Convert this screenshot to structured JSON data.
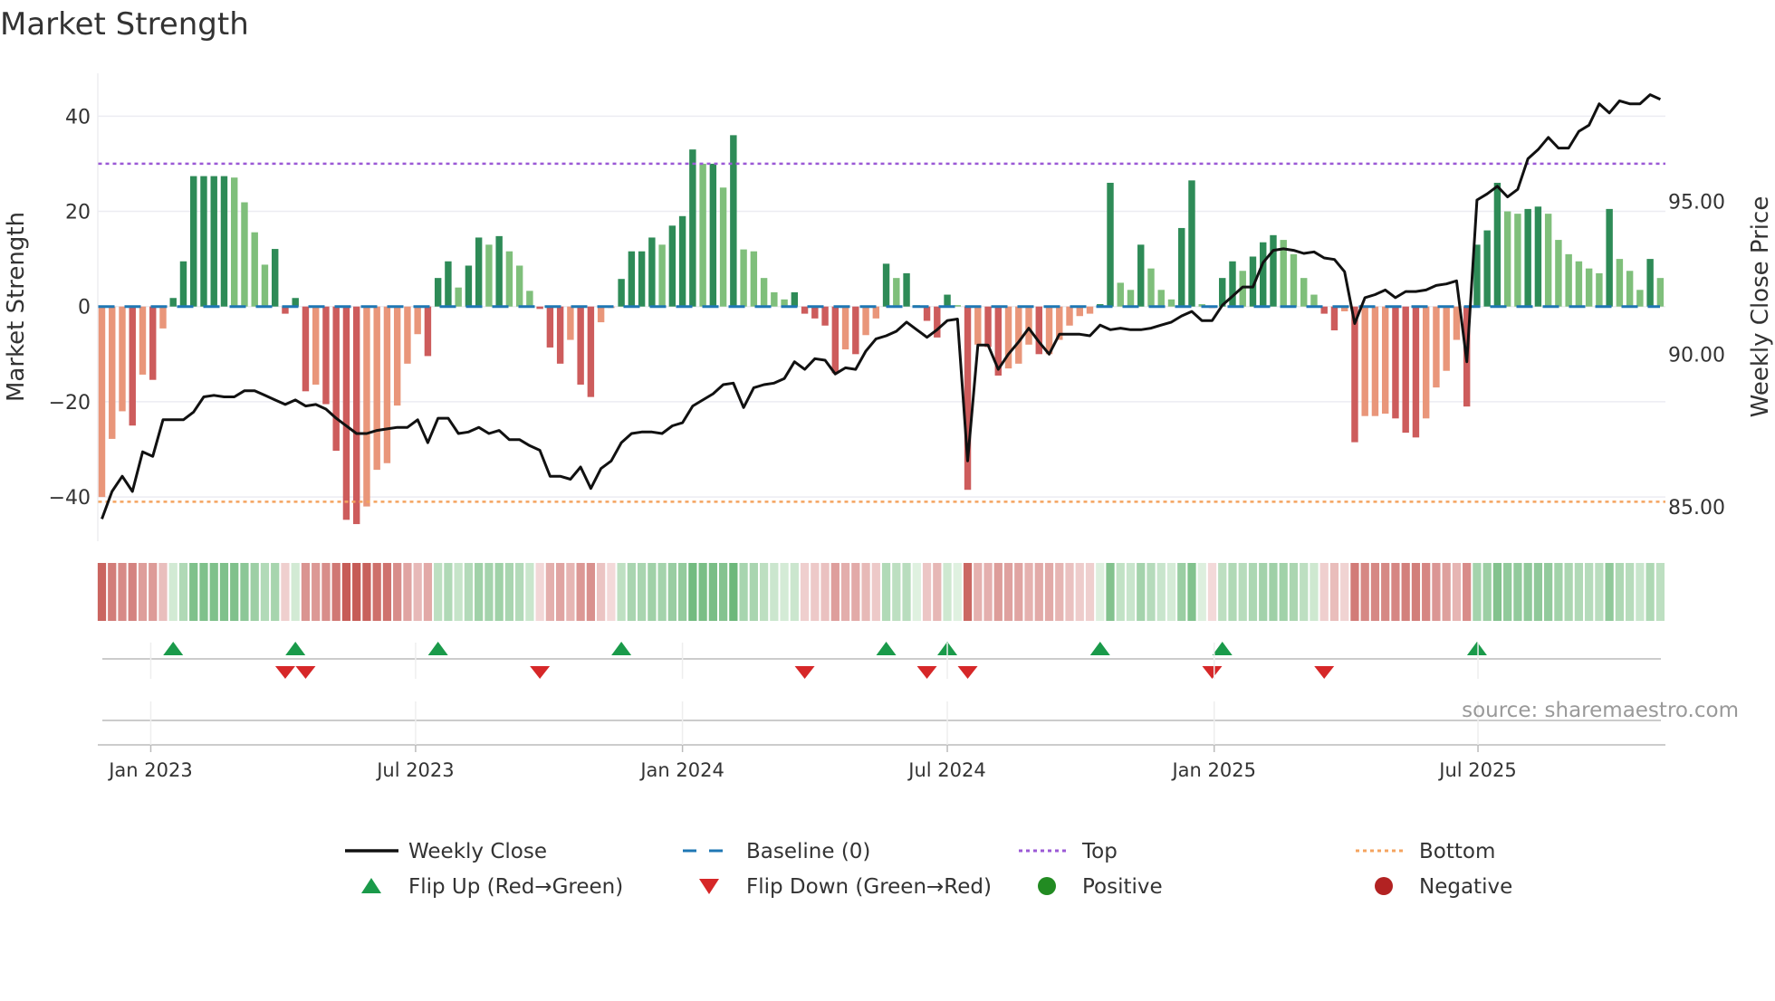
{
  "chart_data": {
    "type": "bar",
    "title": "Market Strength",
    "ylabel": "Market Strength",
    "y2label": "Weekly Close Price",
    "ylim": [
      -49.3,
      49
    ],
    "y2lim": [
      83.87,
      99.2
    ],
    "yticks": [
      40,
      20,
      0,
      -20,
      -40
    ],
    "ytick_labels": [
      "40",
      "20",
      "0",
      "−20",
      "−40"
    ],
    "y2ticks": [
      95,
      90,
      85
    ],
    "y2tick_labels": [
      "95.00",
      "90.00",
      "85.00"
    ],
    "x_unit": "week index",
    "xlim": [
      -0.4,
      153.5
    ],
    "xticks": [
      {
        "week": 4.8,
        "label": "Jan 2023"
      },
      {
        "week": 30.8,
        "label": "Jul 2023"
      },
      {
        "week": 57.0,
        "label": "Jan 2024"
      },
      {
        "week": 83.0,
        "label": "Jul 2024"
      },
      {
        "week": 109.2,
        "label": "Jan 2025"
      },
      {
        "week": 135.1,
        "label": "Jul 2025"
      }
    ],
    "top_level": 30,
    "bottom_level": -41,
    "baseline": 0,
    "strength": [
      -40,
      -27.8,
      -22,
      -25,
      -14.3,
      -15.4,
      -4.6,
      1.8,
      9.5,
      27.4,
      27.4,
      27.4,
      27.4,
      27.1,
      21.9,
      15.6,
      8.8,
      12.1,
      -1.5,
      1.8,
      -17.8,
      -16.4,
      -20.5,
      -30.3,
      -44.8,
      -45.7,
      -42,
      -34.3,
      -32.9,
      -20.8,
      -12,
      -5.8,
      -10.4,
      6,
      9.5,
      4,
      8.6,
      14.5,
      13,
      14.8,
      11.6,
      8.6,
      3.3,
      -0.5,
      -8.6,
      -12,
      -7,
      -16.4,
      -19,
      -3.3,
      -0.3,
      5.8,
      11.6,
      11.6,
      14.5,
      13,
      17,
      19,
      33,
      30,
      30,
      25,
      36,
      12,
      11.6,
      6,
      3,
      1.5,
      3,
      -1.5,
      -2.5,
      -4,
      -14,
      -9,
      -10,
      -6,
      -2.5,
      9,
      6,
      7,
      0.3,
      -3,
      -6.5,
      2.5,
      0.3,
      -38.5,
      -8,
      -8.5,
      -14.5,
      -13,
      -12,
      -8,
      -10,
      -10,
      -7,
      -4,
      -2,
      -1.5,
      0.5,
      26,
      5,
      3.5,
      13,
      8,
      3.5,
      1.5,
      16.5,
      26.5,
      0.5,
      -0.3,
      6,
      9.5,
      7.5,
      10.5,
      13.5,
      15,
      14,
      11,
      6,
      2.5,
      -1.5,
      -5,
      -1,
      -28.5,
      -23,
      -23,
      -22.5,
      -23.5,
      -26.5,
      -27.5,
      -23.5,
      -17,
      -13.5,
      -7,
      -21,
      13,
      16,
      26,
      20,
      19.5,
      20.5,
      21,
      19.5,
      14,
      11,
      9.5,
      8,
      7,
      20.5,
      10,
      7.5,
      3.5,
      10,
      6
    ],
    "weekly_close": [
      84.6,
      85.5,
      86.0,
      85.5,
      86.8,
      86.65,
      87.85,
      87.85,
      87.85,
      88.1,
      88.6,
      88.65,
      88.6,
      88.6,
      88.8,
      88.8,
      88.65,
      88.5,
      88.35,
      88.5,
      88.3,
      88.35,
      88.2,
      87.9,
      87.65,
      87.4,
      87.4,
      87.5,
      87.55,
      87.6,
      87.6,
      87.85,
      87.1,
      87.9,
      87.9,
      87.4,
      87.45,
      87.6,
      87.4,
      87.5,
      87.2,
      87.2,
      87.0,
      86.85,
      86.0,
      86.0,
      85.9,
      86.3,
      85.6,
      86.25,
      86.5,
      87.1,
      87.4,
      87.45,
      87.45,
      87.4,
      87.65,
      87.75,
      88.3,
      88.5,
      88.7,
      89.0,
      89.05,
      88.25,
      88.9,
      89.0,
      89.05,
      89.2,
      89.75,
      89.5,
      89.85,
      89.8,
      89.35,
      89.55,
      89.5,
      90.1,
      90.5,
      90.6,
      90.75,
      91.05,
      90.8,
      90.55,
      90.8,
      91.1,
      91.15,
      86.5,
      90.3,
      90.3,
      89.5,
      90.0,
      90.4,
      90.85,
      90.4,
      90.0,
      90.65,
      90.65,
      90.65,
      90.6,
      90.95,
      90.8,
      90.85,
      90.8,
      90.8,
      90.85,
      90.95,
      91.05,
      91.25,
      91.4,
      91.1,
      91.1,
      91.6,
      91.9,
      92.2,
      92.2,
      93.0,
      93.4,
      93.45,
      93.4,
      93.3,
      93.35,
      93.15,
      93.1,
      92.7,
      91.0,
      91.85,
      91.95,
      92.1,
      91.85,
      92.05,
      92.05,
      92.1,
      92.25,
      92.3,
      92.4,
      89.75,
      95.05,
      95.25,
      95.5,
      95.15,
      95.4,
      96.4,
      96.7,
      97.1,
      96.75,
      96.75,
      97.3,
      97.5,
      98.2,
      97.9,
      98.3,
      98.2,
      98.2,
      98.5,
      98.35
    ],
    "legend": {
      "placement": "bottom",
      "items": [
        {
          "label": "Weekly Close",
          "kind": "line"
        },
        {
          "label": "Baseline (0)",
          "kind": "dash"
        },
        {
          "label": "Top",
          "kind": "dot-purple"
        },
        {
          "label": "Bottom",
          "kind": "dot-orange"
        },
        {
          "label": "Flip Up (Red→Green)",
          "kind": "tri-up"
        },
        {
          "label": "Flip Down (Green→Red)",
          "kind": "tri-down"
        },
        {
          "label": "Positive",
          "kind": "circle-green"
        },
        {
          "label": "Negative",
          "kind": "circle-red"
        }
      ]
    },
    "source": "source: sharemaestro.com",
    "colors": {
      "pos_rising": "#2e8b57",
      "pos_falling": "#7fbf7b",
      "neg_falling": "#cd5c5c",
      "neg_rising": "#e9967a",
      "line": "#111111",
      "baseline": "#1f77b4",
      "top": "#9b59d6",
      "bottom": "#f4a460",
      "flip_up": "#1a9a4a",
      "flip_down": "#d62728",
      "positive": "#228b22",
      "negative": "#b22222"
    }
  }
}
